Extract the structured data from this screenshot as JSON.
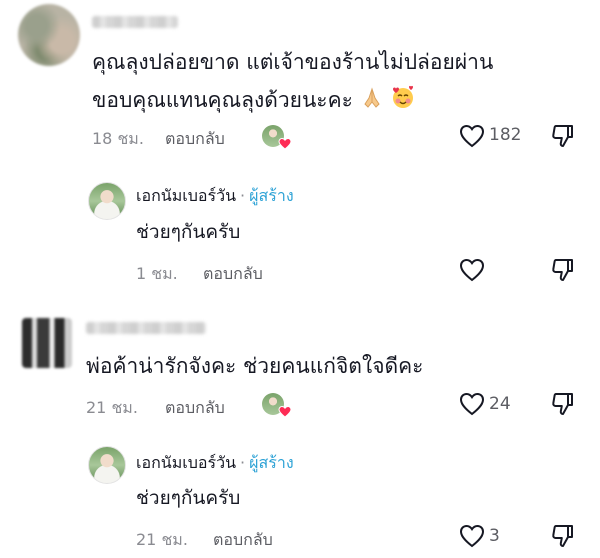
{
  "comments": [
    {
      "text_line1": "คุณลุงปล่อยขาด แต่เจ้าของร้านไม่ปล่อยผ่าน",
      "text_line2": "ขอบคุณแทนคุณลุงด้วยนะคะ",
      "time": "18 ชม.",
      "reply_label": "ตอบกลับ",
      "like_count": "182",
      "reply": {
        "author": "เอกนัมเบอร์วัน",
        "creator_tag": "ผู้สร้าง",
        "separator": "·",
        "text": "ช่วยๆกันครับ",
        "time": "1 ชม.",
        "reply_label": "ตอบกลับ",
        "like_count": ""
      }
    },
    {
      "text_line1": "พ่อค้าน่ารักจังคะ ช่วยคนแก่จิตใจดีคะ",
      "time": "21 ชม.",
      "reply_label": "ตอบกลับ",
      "like_count": "24",
      "reply": {
        "author": "เอกนัมเบอร์วัน",
        "creator_tag": "ผู้สร้าง",
        "separator": "·",
        "text": "ช่วยๆกันครับ",
        "time": "21 ชม.",
        "reply_label": "ตอบกลับ",
        "like_count": "3"
      }
    }
  ],
  "colors": {
    "creator_tag": "#2fa3d6",
    "secondary_text": "#8a8b91",
    "heart_badge": "#fe2c55"
  }
}
